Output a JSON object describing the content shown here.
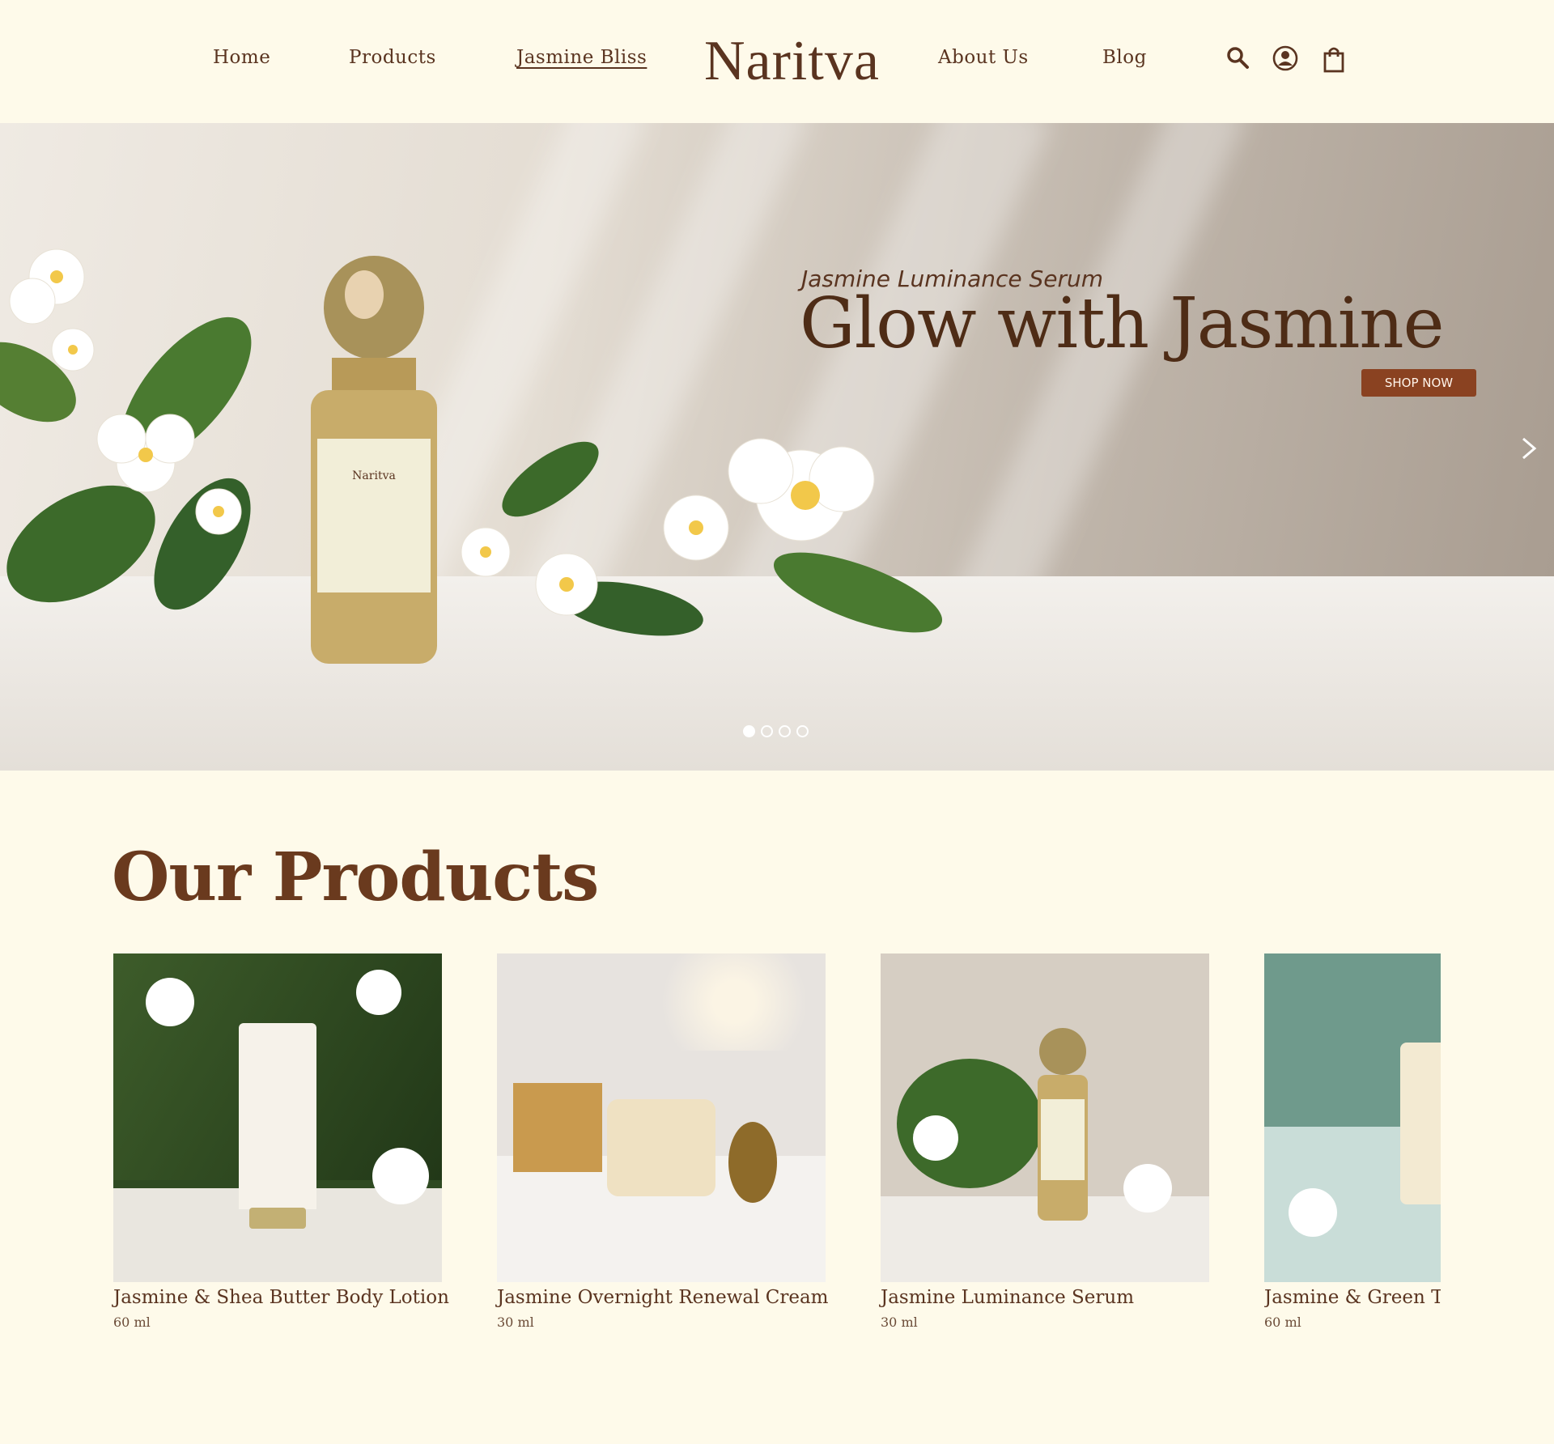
{
  "brand": {
    "logo": "Naritva"
  },
  "nav": {
    "left": [
      {
        "label": "Home"
      },
      {
        "label": "Products"
      },
      {
        "label": "Jasmine Bliss",
        "active": true
      }
    ],
    "right": [
      {
        "label": "About Us"
      },
      {
        "label": "Blog"
      }
    ],
    "icons": [
      "search-icon",
      "account-icon",
      "shopping-bag-icon"
    ]
  },
  "hero": {
    "subtitle": "Jasmine Luminance Serum",
    "title": "Glow with Jasmine",
    "cta": "SHOP NOW",
    "bottle_label": "Naritva",
    "slides_total": 4,
    "active_slide": 1
  },
  "products": {
    "title": "Our Products",
    "items": [
      {
        "name": "Jasmine & Shea Butter Body Lotion",
        "size": "60 ml",
        "bg": "#2f4a22"
      },
      {
        "name": "Jasmine Overnight Renewal Cream",
        "size": "30 ml",
        "bg": "#e7e3df"
      },
      {
        "name": "Jasmine Luminance Serum",
        "size": "30 ml",
        "bg": "#d6cec3"
      },
      {
        "name": "Jasmine & Green Tea",
        "size": "60 ml",
        "bg": "#6f9a8c"
      }
    ]
  },
  "colors": {
    "background": "#fefaea",
    "text": "#5a3420",
    "accent": "#8a4221"
  }
}
